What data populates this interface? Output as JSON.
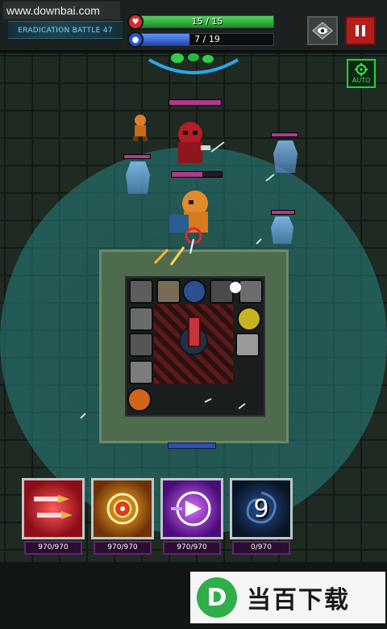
{
  "watermark": "www.downbai.com",
  "battle": {
    "title": "ERADICATION BATTLE 47"
  },
  "hp": {
    "text": "15 / 15",
    "current": 15,
    "max": 15,
    "color": "#3ec24a"
  },
  "mp": {
    "text": "7 / 19",
    "current": 7,
    "max": 19,
    "color": "#3b74e8"
  },
  "buttons": {
    "view_icon": "eye-icon",
    "pause_icon": "pause-icon",
    "auto_label": "AUTO",
    "auto_icon": "crosshair-icon"
  },
  "skills": [
    {
      "name": "bullet-skill",
      "energy": "970/970",
      "theme": "#c01e2a"
    },
    {
      "name": "target-burst-skill",
      "energy": "970/970",
      "theme": "#d08a16"
    },
    {
      "name": "arrow-dash-skill",
      "energy": "970/970",
      "theme": "#8a2bd8"
    },
    {
      "name": "vortex-skill",
      "energy": "0/970",
      "cooldown": "9",
      "theme": "#0f2140"
    }
  ],
  "ad": {
    "logo_letter": "D",
    "text": "当百下载"
  }
}
